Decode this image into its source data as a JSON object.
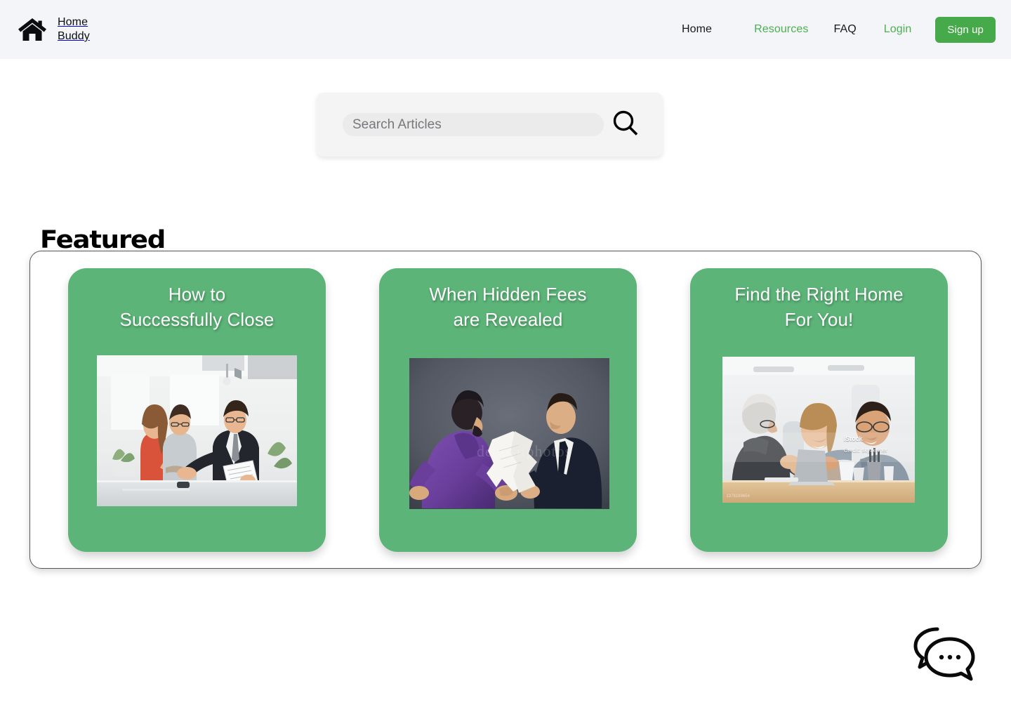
{
  "theme": {
    "header_bg": "#f4f5f9",
    "page_bg": "#ffffff",
    "accent_green": "#4caf50",
    "button_green": "#46a94a",
    "card_green": "#5cb478",
    "text_dark": "#17181c",
    "panel_border": "#55565a"
  },
  "header": {
    "brand": {
      "icon": "house-icon",
      "name": "Home\nBuddy",
      "line1": "Home",
      "line2": "Buddy"
    },
    "nav": [
      {
        "label": "Home",
        "accent": false
      },
      {
        "label": "Resources",
        "accent": true
      },
      {
        "label": "FAQ",
        "accent": false
      },
      {
        "label": "Login",
        "accent": true
      }
    ],
    "signup_label": "Sign up"
  },
  "search": {
    "placeholder": "Search Articles",
    "value": "",
    "icon": "search-icon"
  },
  "featured": {
    "heading": "Featured",
    "cards": [
      {
        "title": "How to\nSuccessfully Close",
        "image_alt": "Real estate agent shaking hands with a couple in a bright modern office"
      },
      {
        "title": "When Hidden Fees\nare Revealed",
        "image_alt": "Two businessmen arguing over torn documents on a dark grey background",
        "watermark_center": "depositphotos"
      },
      {
        "title": "Find the Right Home\nFor You!",
        "image_alt": "Smiling couple talking with an agent across a table in a bright office",
        "watermark_source": "iStock",
        "watermark_credit": "Credit: skynesher",
        "watermark_id": "1376199654"
      }
    ]
  },
  "chat": {
    "icon": "chat-bubbles-icon",
    "label": "Chat"
  }
}
